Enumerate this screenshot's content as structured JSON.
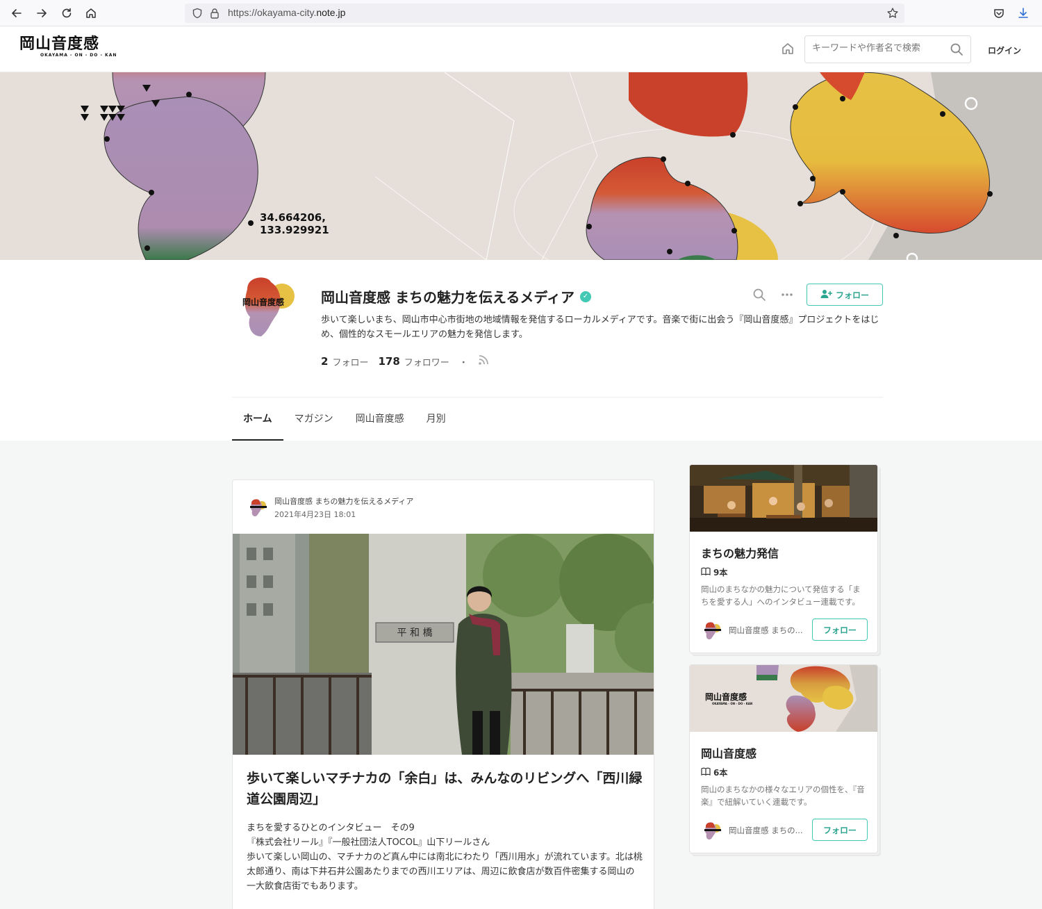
{
  "browser": {
    "url_prefix": "https://okayama-city.",
    "url_domain": "note.jp"
  },
  "header": {
    "logo_text": "岡山音度感",
    "logo_subtext": "OKAYAMA - ON - DO - KAN",
    "search_placeholder": "キーワードや作者名で検索",
    "login_label": "ログイン"
  },
  "banner": {
    "coordinates_line1": "34.664206,",
    "coordinates_line2": "133.929921"
  },
  "profile": {
    "name": "岡山音度感 まちの魅力を伝えるメディア",
    "description": "歩いて楽しいまち、岡山市中心市街地の地域情報を発信するローカルメディアです。音楽で街に出会う『岡山音度感』プロジェクトをはじめ、個性的なスモールエリアの魅力を発信します。",
    "following_count": "2",
    "following_label": "フォロー",
    "followers_count": "178",
    "followers_label": "フォロワー",
    "separator": "・",
    "follow_button": "フォロー"
  },
  "tabs": [
    {
      "label": "ホーム",
      "active": true
    },
    {
      "label": "マガジン",
      "active": false
    },
    {
      "label": "岡山音度感",
      "active": false
    },
    {
      "label": "月別",
      "active": false
    }
  ],
  "feed": {
    "author": "岡山音度感 まちの魅力を伝えるメディア",
    "date": "2021年4月23日 18:01",
    "photo_sign_text": "平 和 橋",
    "title": "歩いて楽しいマチナカの「余白」は、みんなのリビングへ「西川緑道公園周辺」",
    "excerpt_line1": "まちを愛するひとのインタビュー　その9",
    "excerpt_line2": "『株式会社リール』『一般社団法人TOCOL』山下リールさん",
    "excerpt_line3": "歩いて楽しい岡山の、マチナカのど真ん中には南北にわたり「西川用水」が流れています。北は桃太郎通り、南は下井石井公園あたりまでの西川エリアは、周辺に飲食店が数百件密集する岡山の一大飲食店街でもあります。"
  },
  "magazines": [
    {
      "title": "まちの魅力発信",
      "count": "9本",
      "description": "岡山のまちなかの魅力について発信する「まちを愛する人」へのインタビュー連載です。",
      "author": "岡山音度感 まちの...",
      "follow_label": "フォロー"
    },
    {
      "title": "岡山音度感",
      "count": "6本",
      "description": "岡山のまちなかの様々なエリアの個性を、『音楽』で紐解いていく連載です。",
      "author": "岡山音度感 まちの...",
      "follow_label": "フォロー",
      "thumb_logo": "岡山音度感",
      "thumb_sub": "OKAYAMA - ON - DO - KAN"
    }
  ],
  "colors": {
    "accent": "#41c9b4",
    "accent_text": "#2ea691",
    "banner_bg": "#e6dfd9"
  }
}
